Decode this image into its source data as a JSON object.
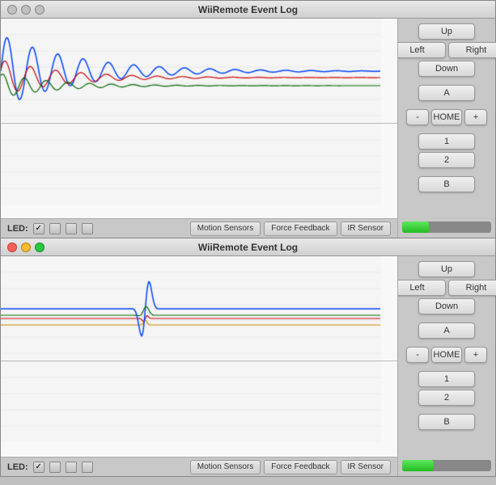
{
  "window1": {
    "title": "WiiRemote Event Log",
    "titlebar_type": "inactive",
    "buttons": {
      "up": "Up",
      "left": "Left",
      "right": "Right",
      "down": "Down",
      "a": "A",
      "home": "HOME",
      "minus": "-",
      "plus": "+",
      "one": "1",
      "two": "2",
      "b": "B"
    },
    "progress": 30,
    "led_label": "LED:",
    "bottom_tabs": [
      "Motion Sensors",
      "Force Feedback",
      "IR Sensor"
    ]
  },
  "window2": {
    "title": "WiiRemote Event Log",
    "titlebar_type": "active",
    "buttons": {
      "up": "Up",
      "left": "Left",
      "right": "Right",
      "down": "Down",
      "a": "A",
      "home": "HOME",
      "minus": "-",
      "plus": "+",
      "one": "1",
      "two": "2",
      "b": "B"
    },
    "progress": 35,
    "led_label": "LED:",
    "bottom_tabs": [
      "Motion Sensors",
      "Force Feedback",
      "IR Sensor"
    ]
  }
}
